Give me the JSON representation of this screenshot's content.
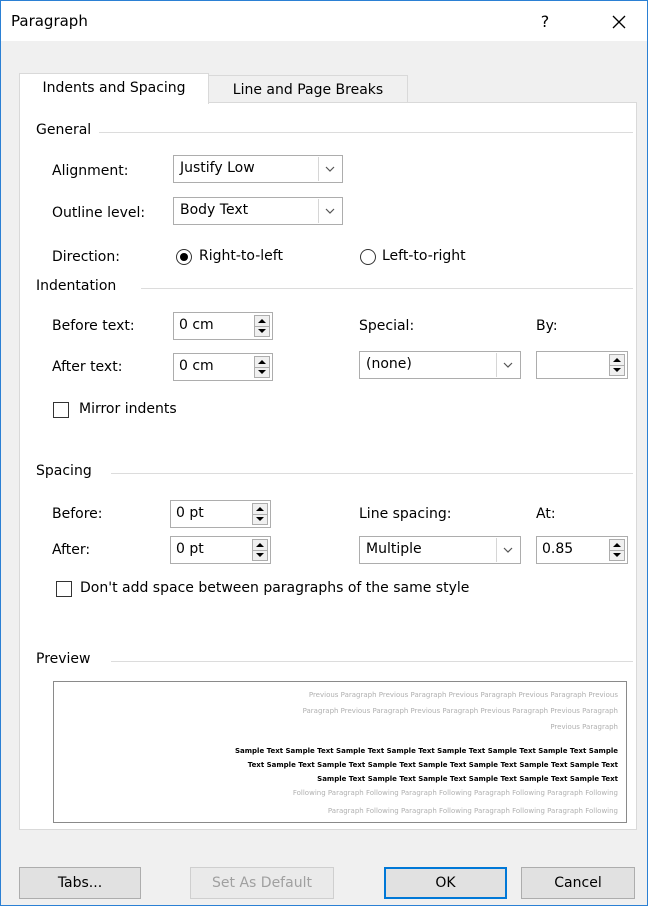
{
  "window": {
    "title": "Paragraph",
    "help": "?",
    "close": "✕"
  },
  "tabs": [
    {
      "label": "Indents and Spacing",
      "active": true
    },
    {
      "label": "Line and Page Breaks",
      "active": false
    }
  ],
  "general": {
    "heading": "General",
    "alignment": {
      "label": "Alignment:",
      "value": "Justify Low"
    },
    "outline_level": {
      "label": "Outline level:",
      "value": "Body Text"
    },
    "direction": {
      "label": "Direction:",
      "options": [
        "Right-to-left",
        "Left-to-right"
      ],
      "selected": "Right-to-left"
    }
  },
  "indentation": {
    "heading": "Indentation",
    "before_text": {
      "label": "Before text:",
      "value": "0 cm"
    },
    "after_text": {
      "label": "After text:",
      "value": "0 cm"
    },
    "special": {
      "label": "Special:",
      "value": "(none)"
    },
    "by": {
      "label": "By:",
      "value": ""
    },
    "mirror": {
      "label": "Mirror indents",
      "checked": false
    }
  },
  "spacing": {
    "heading": "Spacing",
    "before": {
      "label": "Before:",
      "value": "0 pt"
    },
    "after": {
      "label": "After:",
      "value": "0 pt"
    },
    "line_spacing": {
      "label": "Line spacing:",
      "value": "Multiple"
    },
    "at": {
      "label": "At:",
      "value": "0.85"
    },
    "dont_add": {
      "label": "Don't add space between paragraphs of the same style",
      "checked": false
    }
  },
  "preview": {
    "heading": "Preview",
    "lines": [
      "Previous Paragraph Previous Paragraph Previous Paragraph Previous Paragraph Previous",
      "Paragraph Previous Paragraph Previous Paragraph Previous Paragraph Previous Paragraph",
      "Previous Paragraph",
      "Sample Text Sample Text Sample Text Sample Text Sample Text Sample Text Sample Text Sample",
      "Text Sample Text Sample Text Sample Text Sample Text Sample Text Sample Text Sample Text",
      "Sample Text Sample Text Sample Text Sample Text Sample Text Sample Text",
      "Following Paragraph Following Paragraph Following Paragraph Following Paragraph Following",
      "Paragraph Following Paragraph Following Paragraph Following Paragraph Following"
    ]
  },
  "buttons": {
    "tabs": "Tabs...",
    "set_default": "Set As Default",
    "ok": "OK",
    "cancel": "Cancel"
  },
  "colors": {
    "accent": "#0078d7",
    "window_border": "#2b80d4",
    "background": "#f0f0f0"
  }
}
